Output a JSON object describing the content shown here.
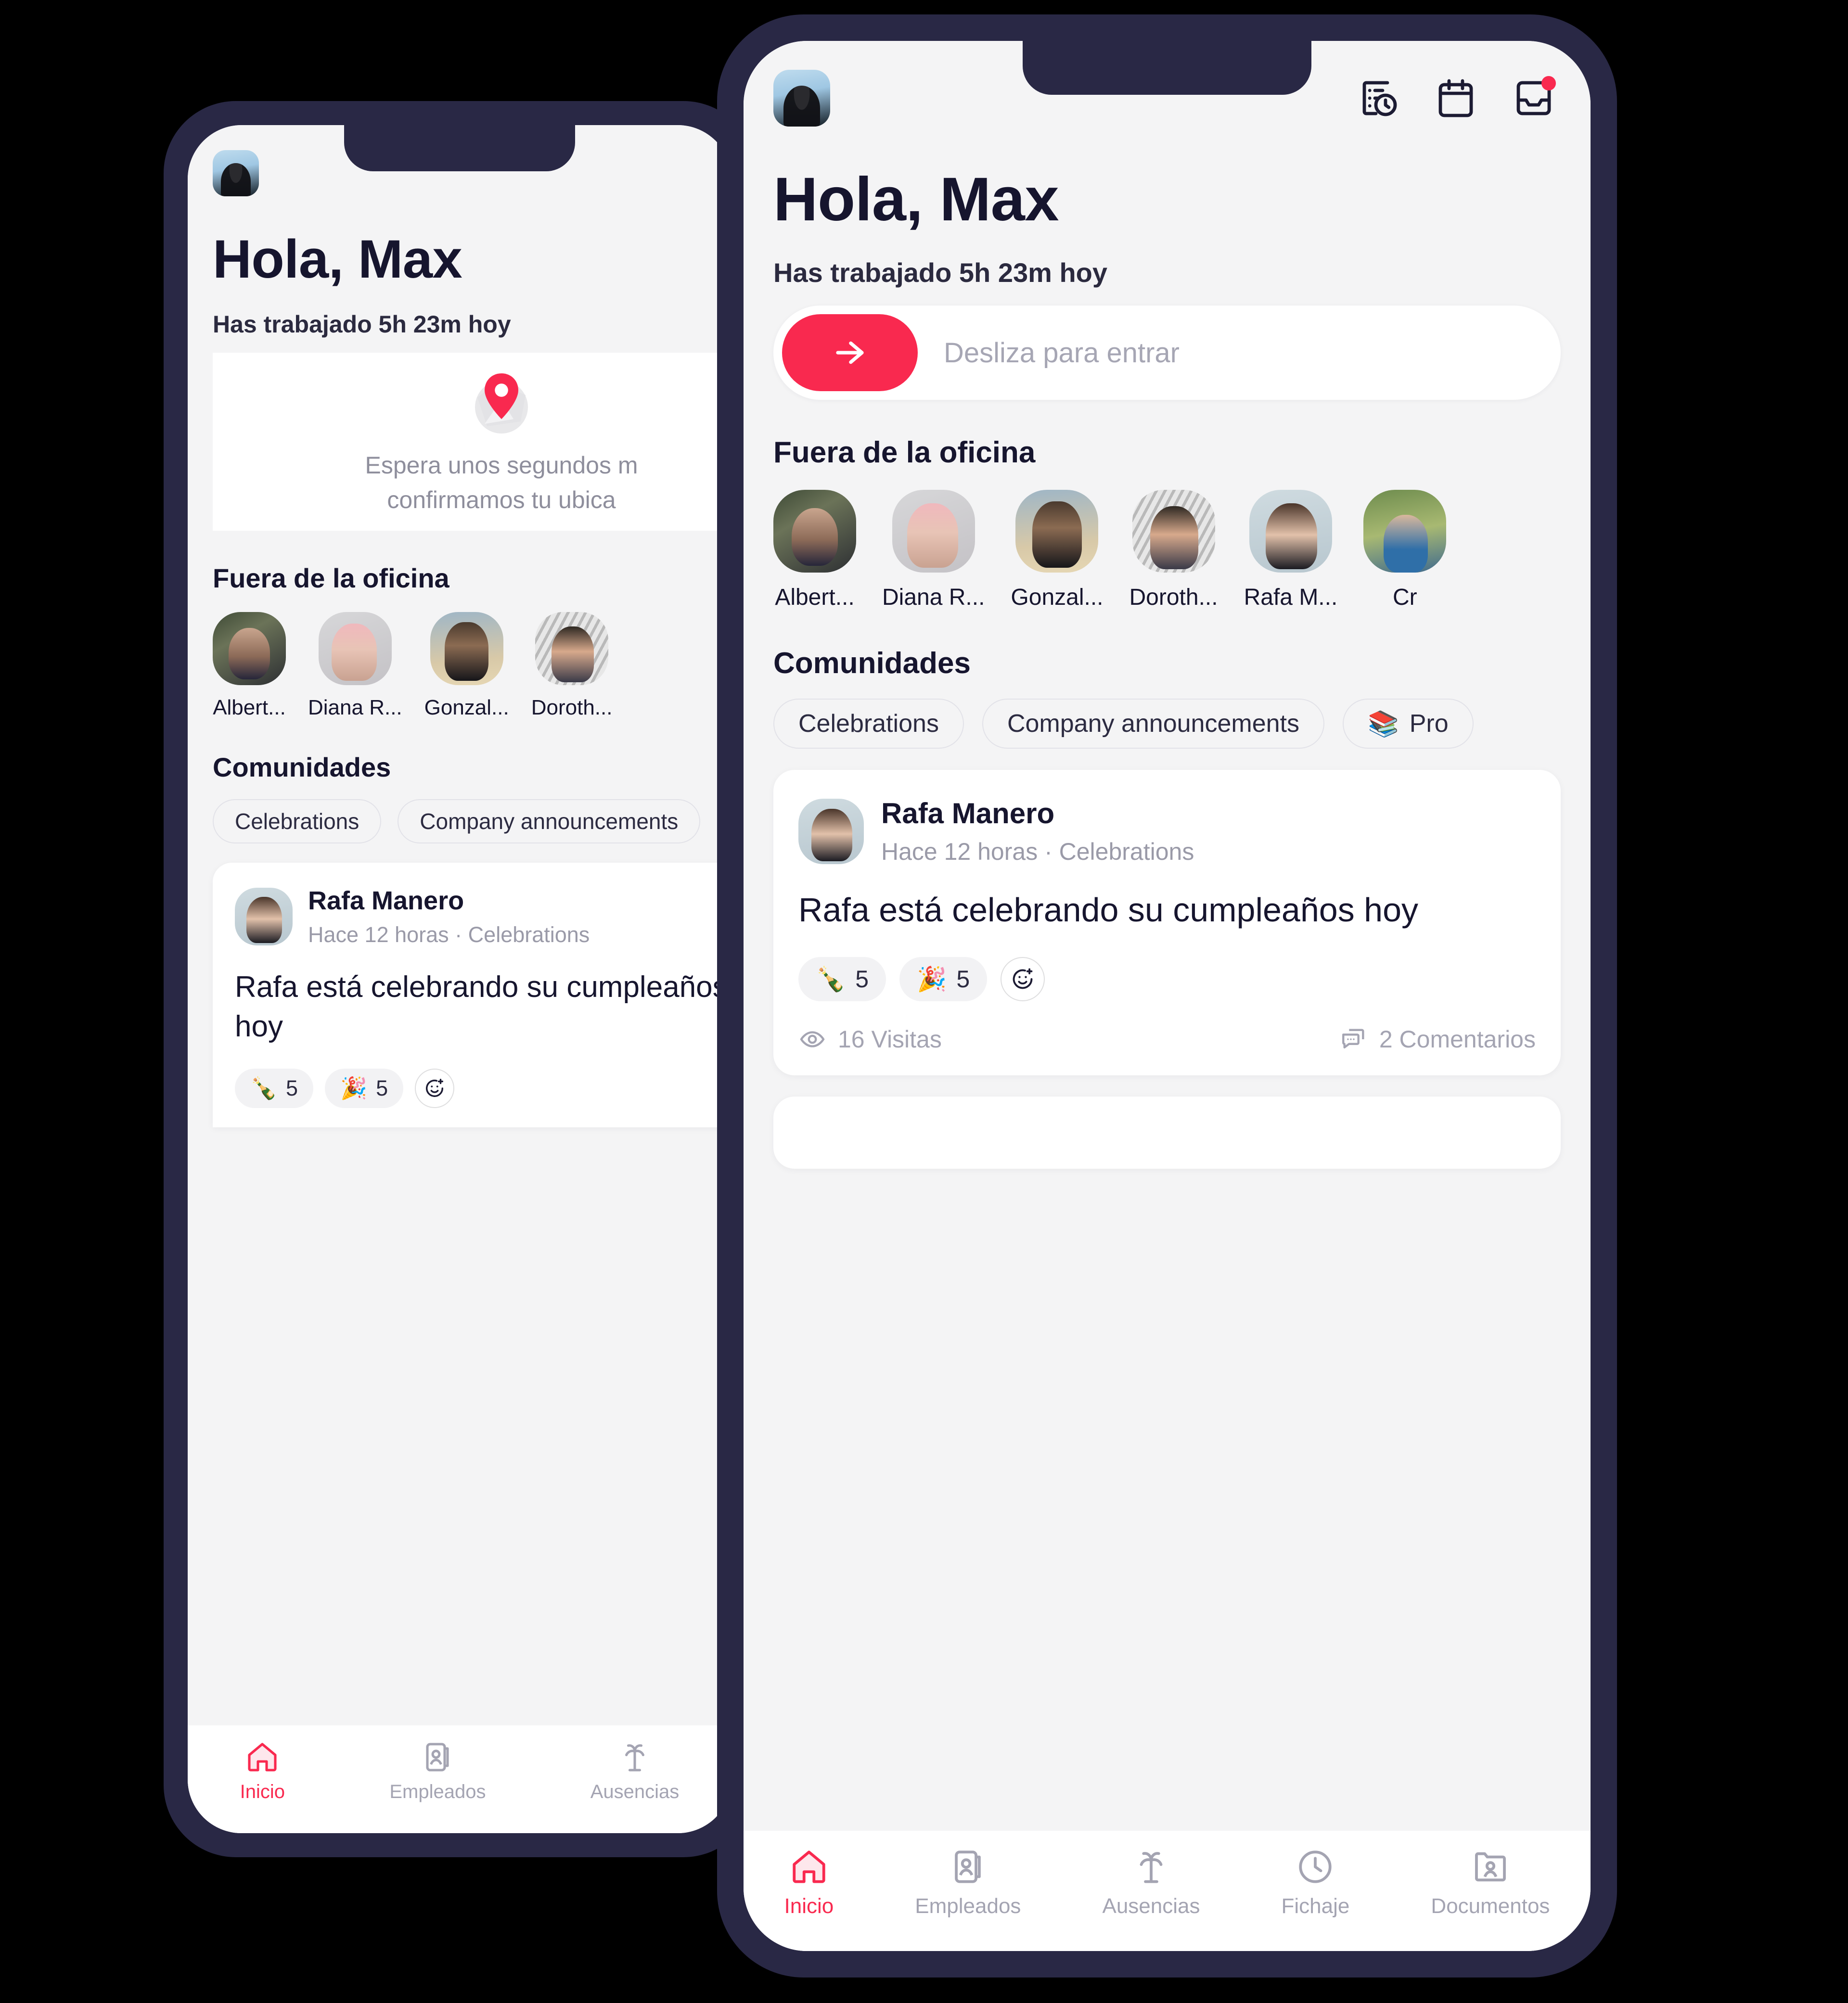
{
  "app": {
    "accent_color": "#f9294f",
    "text_color": "#16152e",
    "frame_color": "#292845",
    "screen_bg": "#f4f4f5"
  },
  "header": {
    "avatar_name": "Max",
    "icons": [
      {
        "name": "time-tracking-icon",
        "label": "Fichajes"
      },
      {
        "name": "calendar-icon",
        "label": "Calendario"
      },
      {
        "name": "inbox-icon",
        "label": "Bandeja",
        "has_badge": true
      }
    ]
  },
  "greeting": "Hola, Max",
  "worked_today": "Has trabajado 5h 23m hoy",
  "clock_in": {
    "slider_label": "Desliza para entrar",
    "arrow": "→"
  },
  "location_card": {
    "line1": "Espera unos segundos m",
    "line2": "confirmamos tu ubica",
    "icon": "map-pin-icon"
  },
  "out_of_office": {
    "title": "Fuera de la oficina",
    "people": [
      {
        "name": "Albert..."
      },
      {
        "name": "Diana R..."
      },
      {
        "name": "Gonzal..."
      },
      {
        "name": "Doroth..."
      },
      {
        "name": "Rafa M..."
      },
      {
        "name": "Cr"
      }
    ]
  },
  "communities": {
    "title": "Comunidades",
    "chips": [
      {
        "emoji": "",
        "label": "Celebrations"
      },
      {
        "emoji": "",
        "label": "Company announcements"
      },
      {
        "emoji": "📚",
        "label": "Pro"
      }
    ]
  },
  "post": {
    "author": "Rafa Manero",
    "meta": "Hace 12 horas  ·  Celebrations",
    "body": "Rafa está celebrando su cumpleaños hoy",
    "reactions": [
      {
        "emoji": "🍾",
        "count": "5"
      },
      {
        "emoji": "🎉",
        "count": "5"
      }
    ],
    "add_reaction_icon": "add-reaction-icon",
    "views": "16 Visitas",
    "comments": "2 Comentarios",
    "views_icon": "eye-icon",
    "comments_icon": "comment-icon"
  },
  "tabbar": {
    "items": [
      {
        "label": "Inicio",
        "icon": "home-icon",
        "active": true
      },
      {
        "label": "Empleados",
        "icon": "employees-icon",
        "active": false
      },
      {
        "label": "Ausencias",
        "icon": "palm-tree-icon",
        "active": false
      },
      {
        "label": "Fichaje",
        "icon": "clock-icon",
        "active": false
      },
      {
        "label": "Documentos",
        "icon": "documents-icon",
        "active": false
      }
    ]
  },
  "tabbar_back": {
    "items": [
      {
        "label": "Inicio",
        "icon": "home-icon",
        "active": true
      },
      {
        "label": "Empleados",
        "icon": "employees-icon",
        "active": false
      },
      {
        "label": "Ausencias",
        "icon": "palm-tree-icon",
        "active": false
      }
    ]
  }
}
